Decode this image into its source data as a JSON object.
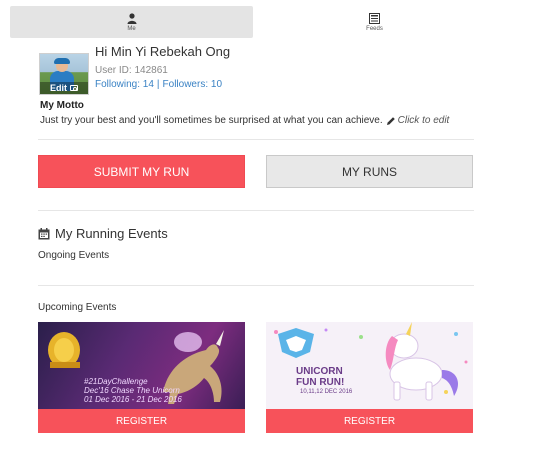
{
  "tabs": [
    {
      "label": "Me",
      "icon": "person-icon",
      "active": true
    },
    {
      "label": "Feeds",
      "icon": "feeds-icon",
      "active": false
    }
  ],
  "profile": {
    "name": "Hi Min Yi Rebekah Ong",
    "user_id": "User ID: 142861",
    "following": "Following: 14",
    "separator": "|",
    "followers": "Followers: 10",
    "avatar_edit_label": "Edit"
  },
  "motto": {
    "title": "My Motto",
    "text": "Just try your best and you'll sometimes be surprised at what you can achieve.",
    "edit_label": "Click to edit"
  },
  "buttons": {
    "submit_run": "SUBMIT MY RUN",
    "my_runs": "MY RUNS"
  },
  "running_events": {
    "title": "My Running Events",
    "ongoing_label": "Ongoing Events",
    "upcoming_label": "Upcoming Events"
  },
  "events": [
    {
      "banner_line1": "#21DayChallenge",
      "banner_line2": "Dec'16 Chase The Unicorn",
      "banner_line3": "01 Dec 2016 - 21 Dec 2016",
      "register_label": "REGISTER"
    },
    {
      "banner_line1": "UNICORN",
      "banner_line2": "FUN RUN!",
      "banner_line3": "10,11,12 DEC 2016",
      "register_label": "REGISTER"
    }
  ],
  "colors": {
    "accent": "#f7525a",
    "link": "#3a82c4",
    "active_tab": "#e4e4e4"
  }
}
